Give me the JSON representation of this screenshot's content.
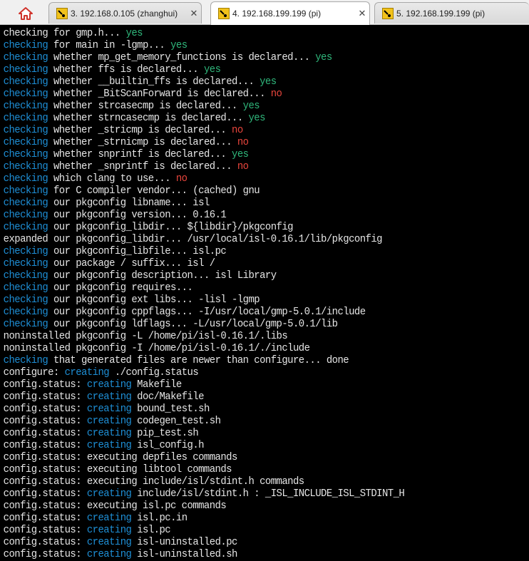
{
  "tabs": [
    {
      "title": "3. 192.168.0.105 (zhanghui)",
      "active": false
    },
    {
      "title": "4. 192.168.199.199 (pi)",
      "active": true
    },
    {
      "title": "5. 192.168.199.199 (pi)",
      "active": false
    }
  ],
  "colors": {
    "accent_blue": "#1e8fd6",
    "yes_green": "#2fb77b",
    "no_red": "#e8453c",
    "terminal_bg": "#000000"
  },
  "terminal": {
    "lines": [
      [
        {
          "t": "checking for gmp.h... "
        },
        {
          "t": "yes",
          "c": "green"
        }
      ],
      [
        {
          "t": "checking",
          "c": "blue"
        },
        {
          "t": " for main in -lgmp... "
        },
        {
          "t": "yes",
          "c": "green"
        }
      ],
      [
        {
          "t": "checking",
          "c": "blue"
        },
        {
          "t": " whether mp_get_memory_functions is declared... "
        },
        {
          "t": "yes",
          "c": "green"
        }
      ],
      [
        {
          "t": "checking",
          "c": "blue"
        },
        {
          "t": " whether ffs is declared... "
        },
        {
          "t": "yes",
          "c": "green"
        }
      ],
      [
        {
          "t": "checking",
          "c": "blue"
        },
        {
          "t": " whether __builtin_ffs is declared... "
        },
        {
          "t": "yes",
          "c": "green"
        }
      ],
      [
        {
          "t": "checking",
          "c": "blue"
        },
        {
          "t": " whether _BitScanForward is declared... "
        },
        {
          "t": "no",
          "c": "red"
        }
      ],
      [
        {
          "t": "checking",
          "c": "blue"
        },
        {
          "t": " whether strcasecmp is declared... "
        },
        {
          "t": "yes",
          "c": "green"
        }
      ],
      [
        {
          "t": "checking",
          "c": "blue"
        },
        {
          "t": " whether strncasecmp is declared... "
        },
        {
          "t": "yes",
          "c": "green"
        }
      ],
      [
        {
          "t": "checking",
          "c": "blue"
        },
        {
          "t": " whether _stricmp is declared... "
        },
        {
          "t": "no",
          "c": "red"
        }
      ],
      [
        {
          "t": "checking",
          "c": "blue"
        },
        {
          "t": " whether _strnicmp is declared... "
        },
        {
          "t": "no",
          "c": "red"
        }
      ],
      [
        {
          "t": "checking",
          "c": "blue"
        },
        {
          "t": " whether snprintf is declared... "
        },
        {
          "t": "yes",
          "c": "green"
        }
      ],
      [
        {
          "t": "checking",
          "c": "blue"
        },
        {
          "t": " whether _snprintf is declared... "
        },
        {
          "t": "no",
          "c": "red"
        }
      ],
      [
        {
          "t": "checking",
          "c": "blue"
        },
        {
          "t": " which clang to use... "
        },
        {
          "t": "no",
          "c": "red"
        }
      ],
      [
        {
          "t": "checking",
          "c": "blue"
        },
        {
          "t": " for C compiler vendor... (cached) gnu"
        }
      ],
      [
        {
          "t": "checking",
          "c": "blue"
        },
        {
          "t": " our pkgconfig libname... isl"
        }
      ],
      [
        {
          "t": "checking",
          "c": "blue"
        },
        {
          "t": " our pkgconfig version... 0.16.1"
        }
      ],
      [
        {
          "t": "checking",
          "c": "blue"
        },
        {
          "t": " our pkgconfig_libdir... ${libdir}/pkgconfig"
        }
      ],
      [
        {
          "t": "expanded our pkgconfig_libdir... /usr/local/isl-0.16.1/lib/pkgconfig"
        }
      ],
      [
        {
          "t": "checking",
          "c": "blue"
        },
        {
          "t": " our pkgconfig_libfile... isl.pc"
        }
      ],
      [
        {
          "t": "checking",
          "c": "blue"
        },
        {
          "t": " our package / suffix... isl /"
        }
      ],
      [
        {
          "t": "checking",
          "c": "blue"
        },
        {
          "t": " our pkgconfig description... isl Library"
        }
      ],
      [
        {
          "t": "checking",
          "c": "blue"
        },
        {
          "t": " our pkgconfig requires..."
        }
      ],
      [
        {
          "t": "checking",
          "c": "blue"
        },
        {
          "t": " our pkgconfig ext libs... -lisl -lgmp"
        }
      ],
      [
        {
          "t": "checking",
          "c": "blue"
        },
        {
          "t": " our pkgconfig cppflags... -I/usr/local/gmp-5.0.1/include"
        }
      ],
      [
        {
          "t": "checking",
          "c": "blue"
        },
        {
          "t": " our pkgconfig ldflags... -L/usr/local/gmp-5.0.1/lib"
        }
      ],
      [
        {
          "t": "noninstalled pkgconfig -L /home/pi/isl-0.16.1/.libs"
        }
      ],
      [
        {
          "t": "noninstalled pkgconfig -I /home/pi/isl-0.16.1/./include"
        }
      ],
      [
        {
          "t": "checking",
          "c": "blue"
        },
        {
          "t": " that generated files are newer than configure... done"
        }
      ],
      [
        {
          "t": "configure: "
        },
        {
          "t": "creating",
          "c": "blue"
        },
        {
          "t": " ./config.status"
        }
      ],
      [
        {
          "t": "config.status: "
        },
        {
          "t": "creating",
          "c": "blue"
        },
        {
          "t": " Makefile"
        }
      ],
      [
        {
          "t": "config.status: "
        },
        {
          "t": "creating",
          "c": "blue"
        },
        {
          "t": " doc/Makefile"
        }
      ],
      [
        {
          "t": "config.status: "
        },
        {
          "t": "creating",
          "c": "blue"
        },
        {
          "t": " bound_test.sh"
        }
      ],
      [
        {
          "t": "config.status: "
        },
        {
          "t": "creating",
          "c": "blue"
        },
        {
          "t": " codegen_test.sh"
        }
      ],
      [
        {
          "t": "config.status: "
        },
        {
          "t": "creating",
          "c": "blue"
        },
        {
          "t": " pip_test.sh"
        }
      ],
      [
        {
          "t": "config.status: "
        },
        {
          "t": "creating",
          "c": "blue"
        },
        {
          "t": " isl_config.h"
        }
      ],
      [
        {
          "t": "config.status: executing depfiles commands"
        }
      ],
      [
        {
          "t": "config.status: executing libtool commands"
        }
      ],
      [
        {
          "t": "config.status: executing include/isl/stdint.h commands"
        }
      ],
      [
        {
          "t": "config.status: "
        },
        {
          "t": "creating",
          "c": "blue"
        },
        {
          "t": " include/isl/stdint.h : _ISL_INCLUDE_ISL_STDINT_H"
        }
      ],
      [
        {
          "t": "config.status: executing isl.pc commands"
        }
      ],
      [
        {
          "t": "config.status: "
        },
        {
          "t": "creating",
          "c": "blue"
        },
        {
          "t": " isl.pc.in"
        }
      ],
      [
        {
          "t": "config.status: "
        },
        {
          "t": "creating",
          "c": "blue"
        },
        {
          "t": " isl.pc"
        }
      ],
      [
        {
          "t": "config.status: "
        },
        {
          "t": "creating",
          "c": "blue"
        },
        {
          "t": " isl-uninstalled.pc"
        }
      ],
      [
        {
          "t": "config.status: "
        },
        {
          "t": "creating",
          "c": "blue"
        },
        {
          "t": " isl-uninstalled.sh"
        }
      ]
    ]
  }
}
